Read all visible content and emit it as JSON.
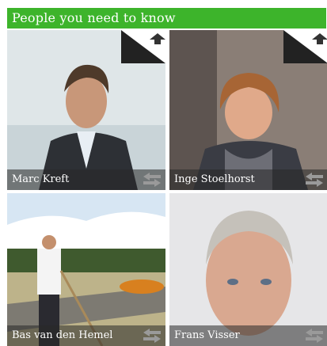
{
  "widget": {
    "title": "People you need to know",
    "people": [
      {
        "name": "Marc Kreft",
        "has_corner": true
      },
      {
        "name": "Inge Stoelhorst",
        "has_corner": true
      },
      {
        "name": "Bas van den Hemel",
        "has_corner": false
      },
      {
        "name": "Frans Visser",
        "has_corner": false
      }
    ]
  },
  "colors": {
    "header_bg": "#3db42b",
    "caption_bg": "#333333"
  }
}
